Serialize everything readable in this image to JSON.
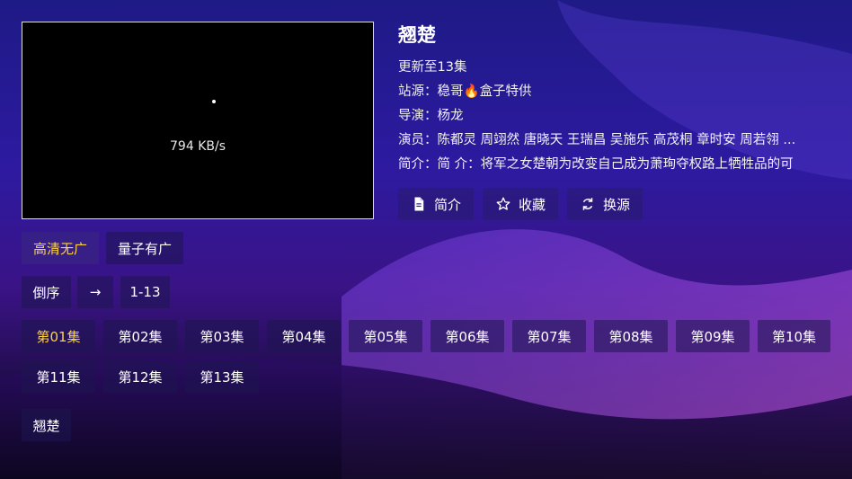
{
  "player": {
    "speed": "794 KB/s"
  },
  "detail": {
    "title": "翘楚",
    "update": "更新至13集",
    "source_label": "站源：",
    "source_name_a": "稳哥",
    "source_name_b": "盒子特供",
    "director_label": "导演：",
    "director": "杨龙",
    "actors_label": "演员：",
    "actors": "陈都灵 周翊然 唐晓天 王瑞昌 吴施乐 高茂桐 章时安 周若翎 ...",
    "intro_label": "简介：",
    "intro": "简 介：将军之女楚朝为改变自己成为萧珣夺权路上牺牲品的可"
  },
  "actions": {
    "intro": "简介",
    "favorite": "收藏",
    "switch_source": "换源"
  },
  "lines": [
    "高清无广",
    "量子有广"
  ],
  "sort": {
    "order": "倒序",
    "arrow": "→",
    "range": "1-13"
  },
  "episodes": [
    "第01集",
    "第02集",
    "第03集",
    "第04集",
    "第05集",
    "第06集",
    "第07集",
    "第08集",
    "第09集",
    "第10集",
    "第11集",
    "第12集",
    "第13集"
  ],
  "related": "翘楚",
  "colors": {
    "accent": "#ffd23c",
    "fire": "#ff8a1c"
  }
}
